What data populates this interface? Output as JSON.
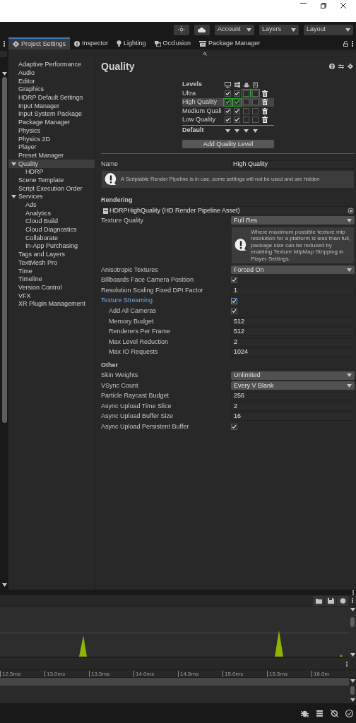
{
  "toolbar": {
    "dropdowns": [
      "Account",
      "Layers",
      "Layout"
    ]
  },
  "tabs": [
    {
      "label": "Project Settings",
      "selected": true
    },
    {
      "label": "Inspector",
      "selected": false
    },
    {
      "label": "Lighting",
      "selected": false
    },
    {
      "label": "Occlusion",
      "selected": false
    },
    {
      "label": "Package Manager",
      "selected": false
    }
  ],
  "sidebar": {
    "items": [
      {
        "label": "Adaptive Performance",
        "selected": false
      },
      {
        "label": "Audio",
        "selected": false
      },
      {
        "label": "Editor",
        "selected": false
      },
      {
        "label": "Graphics",
        "selected": false
      },
      {
        "label": "HDRP Default Settings",
        "selected": false
      },
      {
        "label": "Input Manager",
        "selected": false
      },
      {
        "label": "Input System Package",
        "selected": false
      },
      {
        "label": "Package Manager",
        "selected": false
      },
      {
        "label": "Physics",
        "selected": false
      },
      {
        "label": "Physics 2D",
        "selected": false
      },
      {
        "label": "Player",
        "selected": false
      },
      {
        "label": "Preset Manager",
        "selected": false
      },
      {
        "label": "Quality",
        "selected": true,
        "expanded": true,
        "children": [
          {
            "label": "HDRP",
            "selected": false
          }
        ]
      },
      {
        "label": "Scene Template",
        "selected": false
      },
      {
        "label": "Script Execution Order",
        "selected": false
      },
      {
        "label": "Services",
        "selected": false,
        "expanded": true,
        "children": [
          {
            "label": "Ads",
            "selected": false
          },
          {
            "label": "Analytics",
            "selected": false
          },
          {
            "label": "Cloud Build",
            "selected": false
          },
          {
            "label": "Cloud Diagnostics",
            "selected": false
          },
          {
            "label": "Collaborate",
            "selected": false
          },
          {
            "label": "In-App Purchasing",
            "selected": false
          }
        ]
      },
      {
        "label": "Tags and Layers",
        "selected": false
      },
      {
        "label": "TextMesh Pro",
        "selected": false
      },
      {
        "label": "Time",
        "selected": false
      },
      {
        "label": "Timeline",
        "selected": false
      },
      {
        "label": "Version Control",
        "selected": false
      },
      {
        "label": "VFX",
        "selected": false
      },
      {
        "label": "XR Plugin Management",
        "selected": false
      }
    ]
  },
  "content": {
    "title": "Quality",
    "levels": {
      "heading": "Levels",
      "rows": [
        {
          "name": "Ultra",
          "selected": false,
          "platforms": [
            {
              "checked": true,
              "default": false
            },
            {
              "checked": true,
              "default": false
            },
            {
              "checked": false,
              "default": true
            },
            {
              "checked": false,
              "default": true
            }
          ]
        },
        {
          "name": "High Quality",
          "selected": true,
          "platforms": [
            {
              "checked": true,
              "default": true
            },
            {
              "checked": true,
              "default": true
            },
            {
              "checked": false,
              "default": false
            },
            {
              "checked": false,
              "default": false
            }
          ]
        },
        {
          "name": "Medium Quali",
          "selected": false,
          "platforms": [
            {
              "checked": true,
              "default": false
            },
            {
              "checked": true,
              "default": false
            },
            {
              "checked": false,
              "default": false
            },
            {
              "checked": false,
              "default": false
            }
          ]
        },
        {
          "name": "Low Quality",
          "selected": false,
          "platforms": [
            {
              "checked": true,
              "default": false
            },
            {
              "checked": true,
              "default": false
            },
            {
              "checked": false,
              "default": false
            },
            {
              "checked": false,
              "default": false
            }
          ]
        }
      ],
      "default_label": "Default",
      "add_button": "Add Quality Level"
    },
    "name_field": {
      "label": "Name",
      "value": "High Quality"
    },
    "pipeline_notice": "A Scriptable Render Pipeline is in use, some settings will not be used and are hidden",
    "sections": [
      {
        "title": "Rendering",
        "rows": [
          {
            "kind": "object",
            "value": "HDRPHighQuality (HD Render Pipeline Asset)"
          },
          {
            "kind": "dropdown",
            "label": "Texture Quality",
            "value": "Full Res",
            "focused": false
          },
          {
            "kind": "help",
            "value": "Where maximum possible texture mip resolution for a platform is less than full, package size can be reduced by enabling Texture MipMap Stripping in Player Settings."
          },
          {
            "kind": "dropdown",
            "label": "Anisotropic Textures",
            "value": "Forced On",
            "focused": false
          },
          {
            "kind": "checkbox",
            "label": "Billboards Face Camera Position",
            "checked": true,
            "focused": false
          },
          {
            "kind": "number",
            "label": "Resolution Scaling Fixed DPI Factor",
            "value": "1",
            "focused": false
          },
          {
            "kind": "checkbox",
            "label": "Texture Streaming",
            "checked": true,
            "focused": true,
            "children": [
              {
                "kind": "checkbox",
                "label": "Add All Cameras",
                "checked": true,
                "focused": false
              },
              {
                "kind": "number",
                "label": "Memory Budget",
                "value": "512",
                "focused": false
              },
              {
                "kind": "number",
                "label": "Renderers Per Frame",
                "value": "512",
                "focused": false
              },
              {
                "kind": "number",
                "label": "Max Level Reduction",
                "value": "2",
                "focused": false
              },
              {
                "kind": "number",
                "label": "Max IO Requests",
                "value": "1024",
                "focused": false
              }
            ]
          }
        ]
      },
      {
        "title": "Other",
        "rows": [
          {
            "kind": "dropdown",
            "label": "Skin Weights",
            "value": "Unlimited",
            "focused": false
          },
          {
            "kind": "dropdown",
            "label": "VSync Count",
            "value": "Every V Blank",
            "focused": false
          },
          {
            "kind": "number",
            "label": "Particle Raycast Budget",
            "value": "256",
            "focused": false
          },
          {
            "kind": "number",
            "label": "Async Upload Time Slice",
            "value": "2",
            "focused": false
          },
          {
            "kind": "number",
            "label": "Async Upload Buffer Size",
            "value": "16",
            "focused": false
          },
          {
            "kind": "checkbox",
            "label": "Async Upload Persistent Buffer",
            "checked": true,
            "focused": false
          }
        ]
      }
    ]
  },
  "profiler": {
    "ticks": [
      "12.5ms",
      "13.0ms",
      "13.5ms",
      "14.0ms",
      "14.5ms",
      "15.0ms",
      "15.5ms",
      "16.0m"
    ]
  }
}
